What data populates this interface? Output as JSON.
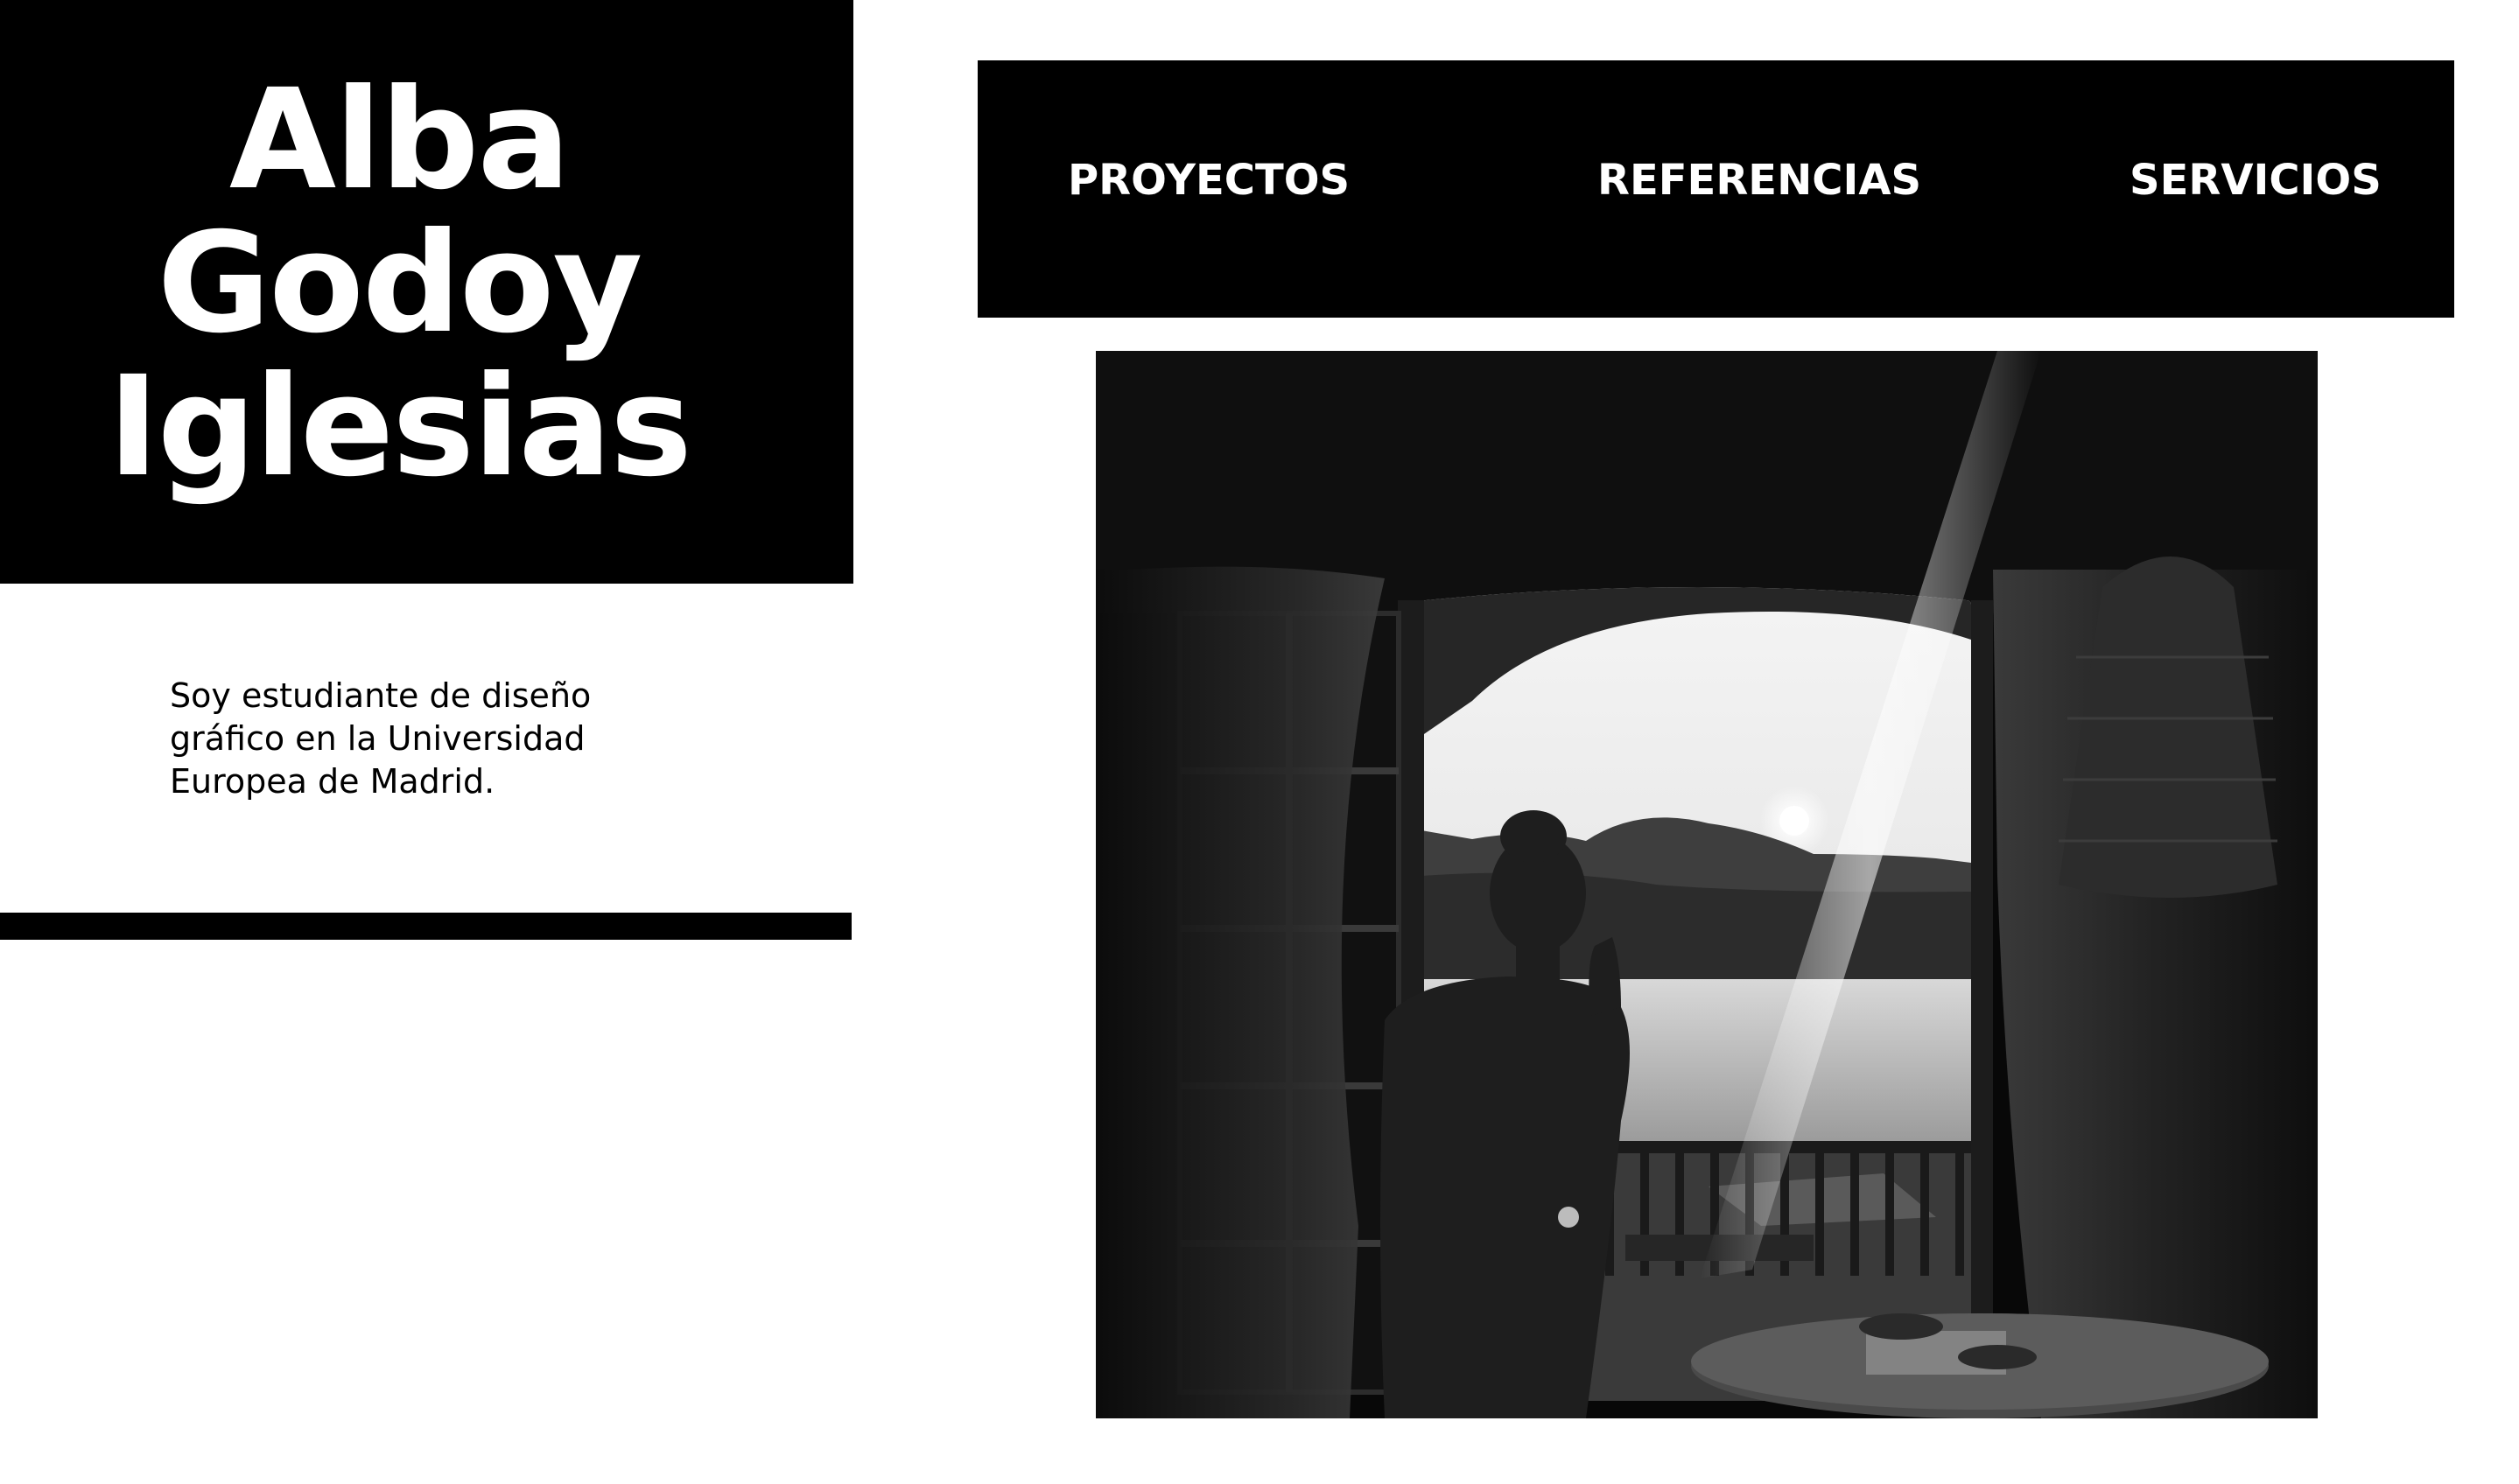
{
  "profile": {
    "name_lines": [
      "Alba",
      "Godoy",
      "Iglesias"
    ],
    "bio": "Soy estudiante de diseño gráfico en la Universidad Europea de Madrid."
  },
  "nav": {
    "items": [
      {
        "label": "PROYECTOS"
      },
      {
        "label": "REFERENCIAS"
      },
      {
        "label": "SERVICIOS"
      }
    ]
  },
  "hero": {
    "image": "black-and-white-photo-woman-at-balcony-window-sea-sunset"
  },
  "colors": {
    "background": "#ffffff",
    "blocks": "#000000",
    "text_on_dark": "#ffffff",
    "text_on_light": "#000000"
  }
}
